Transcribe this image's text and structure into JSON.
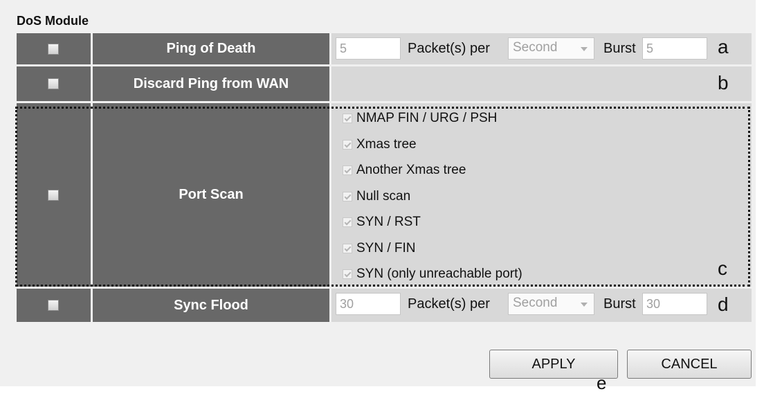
{
  "section_title": "DoS Module",
  "rows": {
    "ping_of_death": {
      "name": "Ping of Death",
      "packets_value": "5",
      "packets_label": "Packet(s) per",
      "unit_selected": "Second",
      "burst_label": "Burst",
      "burst_value": "5",
      "marker": "a"
    },
    "discard_ping": {
      "name": "Discard Ping from WAN",
      "marker": "b"
    },
    "port_scan": {
      "name": "Port Scan",
      "items": [
        "NMAP FIN / URG / PSH",
        "Xmas tree",
        "Another Xmas tree",
        "Null scan",
        "SYN / RST",
        "SYN / FIN",
        "SYN (only unreachable port)"
      ],
      "marker": "c"
    },
    "sync_flood": {
      "name": "Sync Flood",
      "packets_value": "30",
      "packets_label": "Packet(s) per",
      "unit_selected": "Second",
      "burst_label": "Burst",
      "burst_value": "30",
      "marker": "d"
    }
  },
  "buttons": {
    "apply": "APPLY",
    "cancel": "CANCEL",
    "marker": "e"
  },
  "colors": {
    "header_cell": "#686868",
    "value_cell": "#d8d8d8",
    "panel": "#f0f0f0"
  }
}
